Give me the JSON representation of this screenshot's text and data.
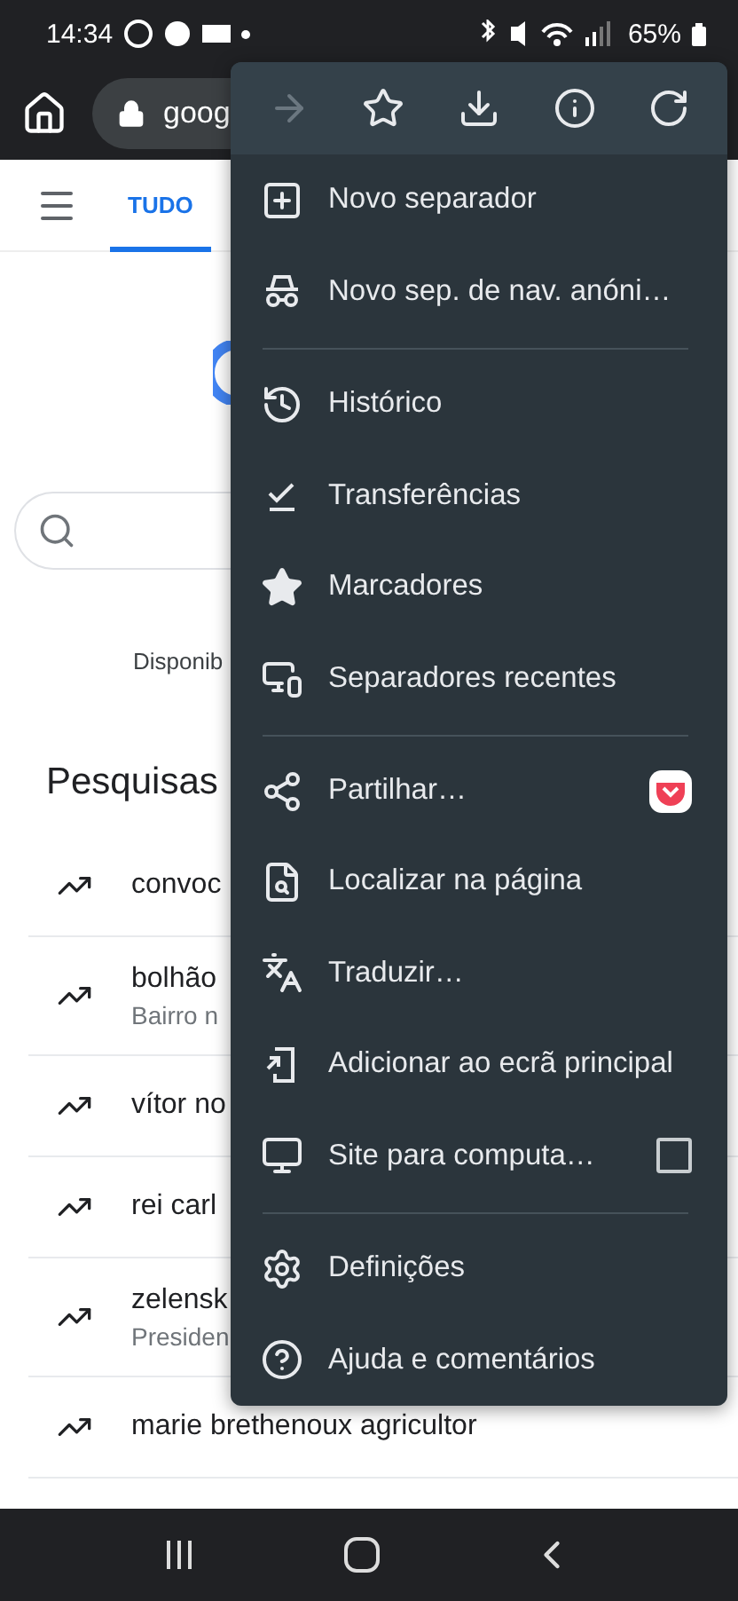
{
  "status_bar": {
    "time": "14:34",
    "battery": "65%"
  },
  "toolbar": {
    "address": "goog"
  },
  "page": {
    "tabs": [
      {
        "label": "TUDO",
        "selected": true
      }
    ],
    "availability": "Disponib",
    "heading": "Pesquisas",
    "trends": [
      {
        "title": "convoc"
      },
      {
        "title": "bolhão",
        "subtitle": "Bairro n"
      },
      {
        "title": "vítor no"
      },
      {
        "title": "rei carl"
      },
      {
        "title": "zelensk",
        "subtitle": "Presiden"
      },
      {
        "title": "marie brethenoux agricultor"
      }
    ]
  },
  "menu": {
    "actions": [
      {
        "kind": "forward",
        "disabled": true
      },
      {
        "kind": "bookmark",
        "disabled": false
      },
      {
        "kind": "download",
        "disabled": false
      },
      {
        "kind": "info",
        "disabled": false
      },
      {
        "kind": "reload",
        "disabled": false
      }
    ],
    "groups": [
      [
        {
          "kind": "new-tab",
          "label": "Novo separador"
        },
        {
          "kind": "incognito",
          "label": "Novo sep. de nav. anóni…"
        }
      ],
      [
        {
          "kind": "history",
          "label": "Histórico"
        },
        {
          "kind": "downloads",
          "label": "Transferências"
        },
        {
          "kind": "bookmarks",
          "label": "Marcadores"
        },
        {
          "kind": "recent-tabs",
          "label": "Separadores recentes"
        }
      ],
      [
        {
          "kind": "share",
          "label": "Partilhar…"
        },
        {
          "kind": "find",
          "label": "Localizar na página"
        },
        {
          "kind": "translate",
          "label": "Traduzir…"
        },
        {
          "kind": "add-home",
          "label": "Adicionar ao ecrã principal"
        },
        {
          "kind": "desktop",
          "label": "Site para computa…",
          "checked": false
        }
      ],
      [
        {
          "kind": "settings",
          "label": "Definições"
        },
        {
          "kind": "help",
          "label": "Ajuda e comentários"
        }
      ]
    ]
  }
}
